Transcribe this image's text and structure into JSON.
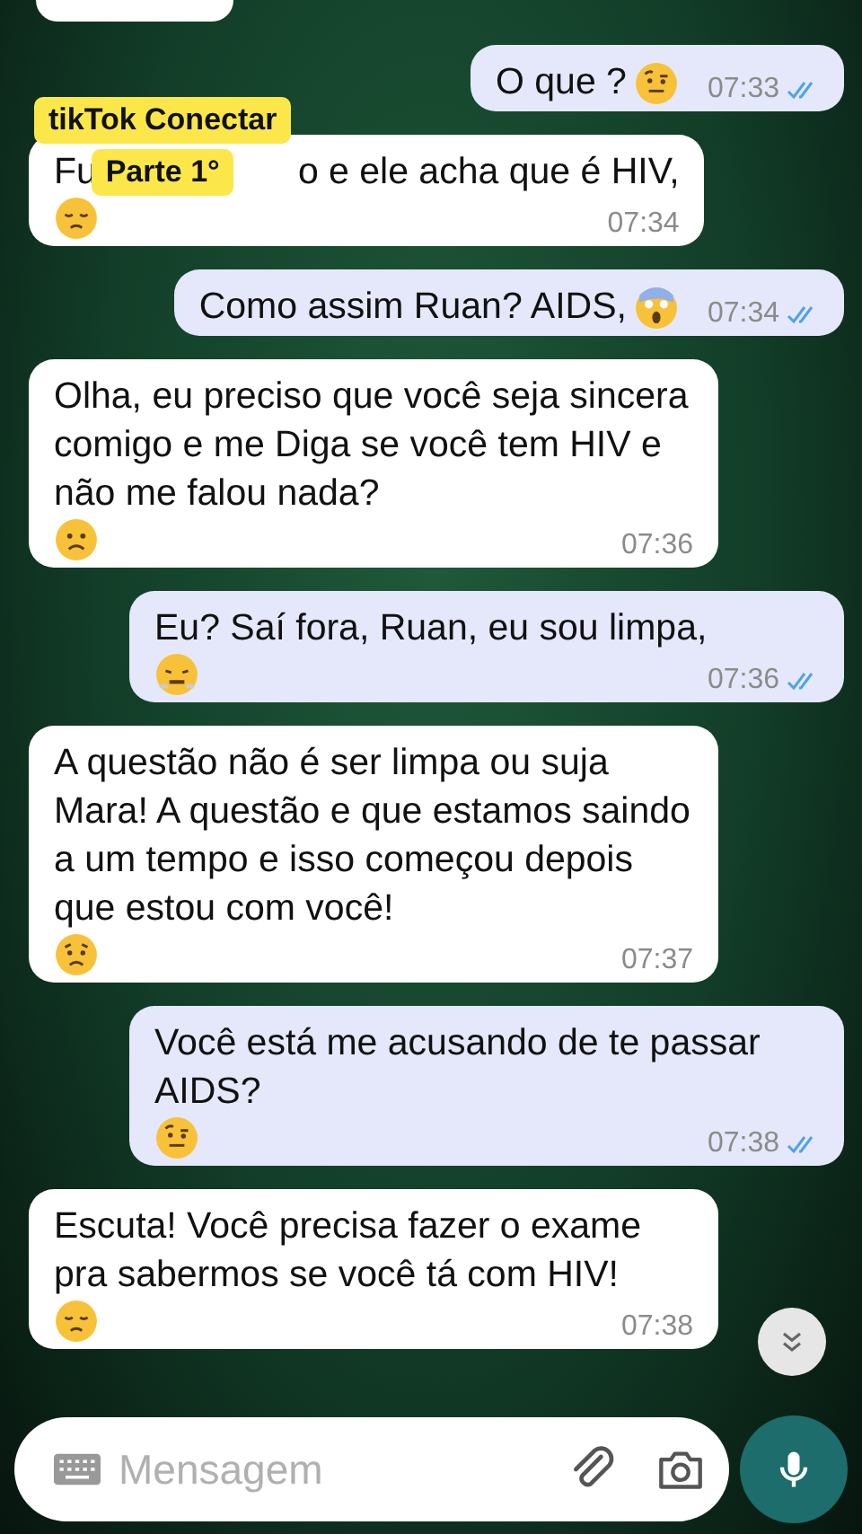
{
  "messages": [
    {
      "outgoing": true,
      "kind": "text",
      "text": "O que ?",
      "emoji": {
        "kind": "raised-eyebrow"
      },
      "time": "07:33",
      "read": true
    },
    {
      "outgoing": false,
      "kind": "covered",
      "parts": [
        "Fu",
        "o e ele acha que é HIV,"
      ],
      "emoji": {
        "kind": "sad"
      },
      "time": "07:34"
    },
    {
      "outgoing": true,
      "kind": "text",
      "text": "Como assim Ruan? AIDS,",
      "emoji": {
        "kind": "scream"
      },
      "time": "07:34",
      "read": true
    },
    {
      "outgoing": false,
      "kind": "text",
      "text": "Olha, eu preciso que você seja sincera comigo e me Diga se você tem HIV e não me falou nada?",
      "emoji": {
        "kind": "frown"
      },
      "time": "07:36"
    },
    {
      "outgoing": true,
      "kind": "text",
      "text": "Eu? Saí fora, Ruan, eu sou limpa,",
      "emoji": {
        "kind": "steam"
      },
      "time": "07:36",
      "read": true
    },
    {
      "outgoing": false,
      "kind": "text",
      "text": "A questão não é ser limpa ou suja Mara! A questão e que estamos saindo a um tempo e isso começou depois que estou com você!",
      "emoji": {
        "kind": "worried"
      },
      "time": "07:37"
    },
    {
      "outgoing": true,
      "kind": "text",
      "text": "Você está me acusando de te passar AIDS?",
      "emoji": {
        "kind": "raised-eyebrow"
      },
      "time": "07:38",
      "read": true
    },
    {
      "outgoing": false,
      "kind": "text",
      "text": "Escuta! Você precisa fazer o exame pra sabermos se você tá com HIV!",
      "emoji": {
        "kind": "sad"
      },
      "time": "07:38"
    }
  ],
  "overlay": {
    "lines": [
      "tikTok Conectar",
      "Parte 1°"
    ]
  },
  "composer": {
    "placeholder": "Mensagem"
  }
}
